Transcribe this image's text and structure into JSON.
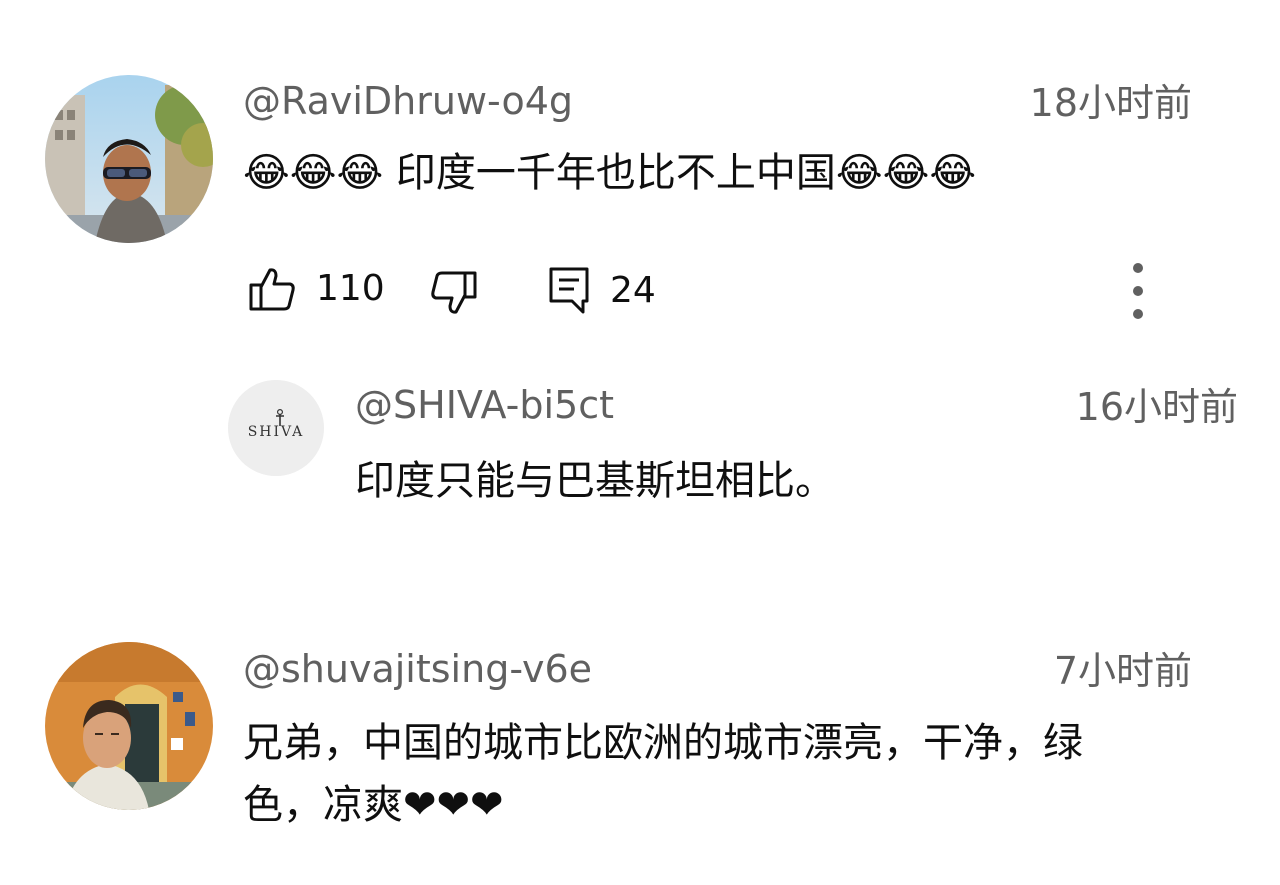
{
  "comments": [
    {
      "handle": "@RaviDhruw-o4g",
      "time": "18小时前",
      "text": "😂😂😂 印度一千年也比不上中国😂😂😂",
      "likes": "110",
      "replies": "24",
      "avatar_icon": "user-avatar-photo"
    },
    {
      "handle": "@shuvajitsing-v6e",
      "time": "7小时前",
      "text": "兄弟，中国的城市比欧洲的城市漂亮，干净，绿色，凉爽❤❤❤",
      "avatar_icon": "user-avatar-illustration"
    }
  ],
  "reply": {
    "handle": "@SHIVA-bi5ct",
    "time": "16小时前",
    "text": "印度只能与巴基斯坦相比。",
    "avatar_logo_text": "SHIVA"
  },
  "icons": {
    "like": "thumbs-up-icon",
    "dislike": "thumbs-down-icon",
    "reply": "reply-icon",
    "more": "more-vertical-icon"
  },
  "colors": {
    "secondary_text": "#606060",
    "primary_text": "#0f0f0f",
    "background": "#ffffff"
  }
}
